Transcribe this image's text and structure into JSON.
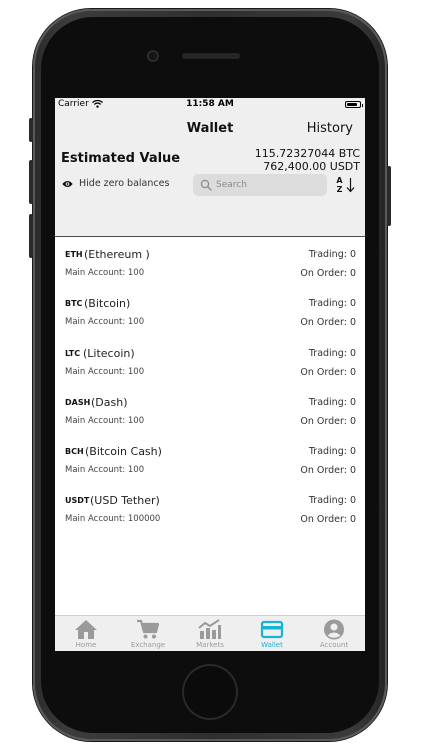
{
  "status": {
    "carrier": "Carrier",
    "time": "11:58 AM",
    "battery_level": 0.85
  },
  "header": {
    "title": "Wallet",
    "history_label": "History",
    "estimated_label": "Estimated Value",
    "btc_value": "115.72327044 BTC",
    "usdt_value": "762,400.00 USDT",
    "hide_zero_label": "Hide zero balances",
    "search_placeholder": "Search",
    "sort_label": "A Z"
  },
  "assets": [
    {
      "symbol": "ETH",
      "name": "(Ethereum )",
      "trading": "Trading: 0",
      "main": "Main Account: 100",
      "on_order": "On Order: 0"
    },
    {
      "symbol": "BTC",
      "name": "(Bitcoin)",
      "trading": "Trading: 0",
      "main": "Main Account: 100",
      "on_order": "On Order: 0"
    },
    {
      "symbol": "LTC",
      "name": "(Litecoin)",
      "trading": "Trading: 0",
      "main": "Main Account: 100",
      "on_order": "On Order: 0"
    },
    {
      "symbol": "DASH",
      "name": "(Dash)",
      "trading": "Trading: 0",
      "main": "Main Account: 100",
      "on_order": "On Order: 0"
    },
    {
      "symbol": "BCH",
      "name": "(Bitcoin Cash)",
      "trading": "Trading: 0",
      "main": "Main Account: 100",
      "on_order": "On Order: 0"
    },
    {
      "symbol": "USDT",
      "name": "(USD Tether)",
      "trading": "Trading: 0",
      "main": "Main Account: 100000",
      "on_order": "On Order: 0"
    }
  ],
  "tabs": [
    {
      "label": "Home",
      "icon": "home-icon"
    },
    {
      "label": "Exchange",
      "icon": "cart-icon"
    },
    {
      "label": "Markets",
      "icon": "chart-icon"
    },
    {
      "label": "Wallet",
      "icon": "wallet-icon",
      "active": true
    },
    {
      "label": "Account",
      "icon": "account-icon"
    }
  ],
  "colors": {
    "accent": "#17b3d4",
    "inactive": "#9a9a9a",
    "header_bg": "#efefef"
  }
}
